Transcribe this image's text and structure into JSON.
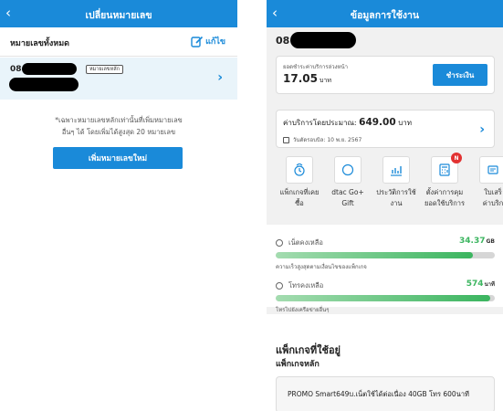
{
  "left": {
    "title": "เปลี่ยนหมายเลข",
    "section_label": "หมายเลขทั้งหมด",
    "edit_label": "แก้ไข",
    "number_prefix": "08",
    "badge": "หมายเลขหลัก",
    "info_line1": "*เฉพาะหมายเลขหลักเท่านั้นที่เพิ่มหมายเลข",
    "info_line2": "อื่นๆ ได้ โดยเพิ่มได้สูงสุด 20 หมายเลข",
    "add_button": "เพิ่มหมายเลขใหม่"
  },
  "right": {
    "title": "ข้อมูลการใช้งาน",
    "phone_prefix": "08",
    "prepay_label": "ยอดชำระค่าบริการล่วงหน้า",
    "prepay_amount": "17.05",
    "prepay_unit": "บาท",
    "pay_button": "ชำระเงิน",
    "estimate_label": "ค่าบริการโดยประมาณ:",
    "estimate_amount": "649.00",
    "estimate_unit": "บาท",
    "cycle_label": "วันตัดรอบบิล: 10 พ.ย. 2567",
    "menu": [
      {
        "label1": "แพ็กเกจที่เคย",
        "label2": "ซื้อ",
        "icon": "package-history-icon"
      },
      {
        "label1": "dtac Go+",
        "label2": "Gift",
        "icon": "gift-circle-icon"
      },
      {
        "label1": "ประวัติการใช้",
        "label2": "งาน",
        "icon": "usage-chart-icon"
      },
      {
        "label1": "ตั้งค่าการคุม",
        "label2": "ยอดใช้บริการ",
        "icon": "calculator-icon",
        "badge": "N"
      },
      {
        "label1": "ใบเสร็",
        "label2": "ค่าบริก",
        "icon": "receipt-icon"
      }
    ],
    "data_label": "เน็ตคงเหลือ",
    "data_remaining": "34.37",
    "data_unit": "GB",
    "data_fraction": 0.9,
    "data_note": "ความเร็วสูงสุดตามเงื่อนไขของแพ็กเกจ",
    "voice_label": "โทรคงเหลือ",
    "voice_remaining": "574",
    "voice_unit": "นาที",
    "voice_fraction": 0.98,
    "voice_note": "โทรไปยังเครือข่ายอื่นๆ",
    "packages_title": "แพ็กเกจที่ใช้อยู่",
    "main_package_label": "แพ็กเกจหลัก",
    "package_name": "PROMO Smart649บ.เน็ตใช้ได้ต่อเนื่อง 40GB โทร 600นาที"
  },
  "colors": {
    "accent": "#1a8ad9",
    "success": "#3bb55f",
    "notification": "#e23232"
  }
}
